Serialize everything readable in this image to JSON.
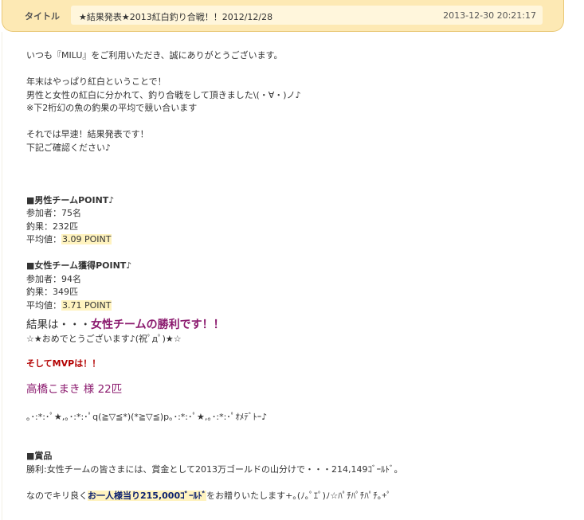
{
  "header": {
    "label": "タイトル",
    "title": "★結果発表★2013紅白釣り合戦！！2012/12/28",
    "datetime": "2013-12-30 20:21:17"
  },
  "body": {
    "intro": "いつも『MILU』をご利用いただき、誠にありがとうございます。",
    "p2_1": "年末はやっぱり紅白ということで！",
    "p2_2": "男性と女性の紅白に分かれて、釣り合戦をして頂きました\\(・∀・)ノ♪",
    "p2_3": "※下2桁幻の魚の釣果の平均で競い合います",
    "p3_1": "それでは早速！結果発表です！",
    "p3_2": "下記ご確認ください♪",
    "male_heading": "■男性チームPOINT♪",
    "male_participants": "参加者：75名",
    "male_catch": "釣果：232匹",
    "male_avg_label": "平均値：",
    "male_avg_value": "3.09 POINT",
    "female_heading": "■女性チーム獲得POINT♪",
    "female_participants": "参加者：94名",
    "female_catch": "釣果：349匹",
    "female_avg_label": "平均値：",
    "female_avg_value": "3.71 POINT",
    "result_prefix": "結果は・・・",
    "result_winner": "女性チームの勝利です！！",
    "congrats": "☆★おめでとうございます♪(祝ﾟдﾟ)★☆",
    "mvp_heading": "そしてMVPは！！",
    "mvp_name": "高橋こまき 様 22匹",
    "kaomoji_line": "｡･:*:･ﾟ★,｡･:*:･ﾟq(≧▽≦*)(*≧▽≦)p｡･:*:･ﾟ★,｡･:*:･ﾟｵﾒﾃﾞﾄｰ♪",
    "prize_heading": "■賞品",
    "prize_line": "勝利:女性チームの皆さまには、賞金として2013万ゴールドの山分けで・・・214,149ｺﾞｰﾙﾄﾞ。",
    "final_prefix": "なのでキリ良く",
    "final_highlight": "お一人様当り215,000ｺﾞｰﾙﾄﾞ",
    "final_suffix": "をお贈りいたします+｡(ﾉ｡ﾟｴﾟ)ﾉ☆ﾊﾟﾁﾊﾟﾁﾊﾟﾁ｡+ﾟ"
  }
}
